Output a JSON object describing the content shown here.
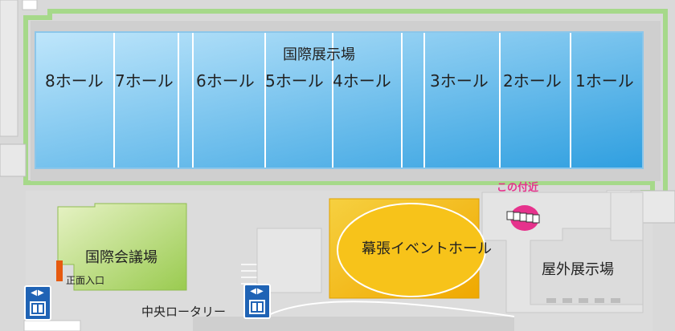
{
  "halls": {
    "exhibition_title": "国際展示場",
    "hall_8": "8ホール",
    "hall_7": "7ホール",
    "hall_6": "6ホール",
    "hall_5": "5ホール",
    "hall_4": "4ホール",
    "hall_3": "3ホール",
    "hall_2": "2ホール",
    "hall_1": "1ホール"
  },
  "venues": {
    "convention": "国際会議場",
    "event_hall": "幕張イベントホール",
    "outdoor": "屋外展示場"
  },
  "labels": {
    "main_entrance": "正面入口",
    "central_rotary": "中央ロータリー",
    "near_here": "この付近"
  },
  "icons": [
    "elevator-icon",
    "elevator-icon",
    "location-marker-icon"
  ],
  "colors": {
    "hall_blue": "#4aaee8",
    "convention_green": "#a8d060",
    "event_yellow": "#f0b400",
    "marker_pink": "#e6328c",
    "outline_green": "#a6d98a",
    "elevator_blue": "#1f63b5"
  }
}
